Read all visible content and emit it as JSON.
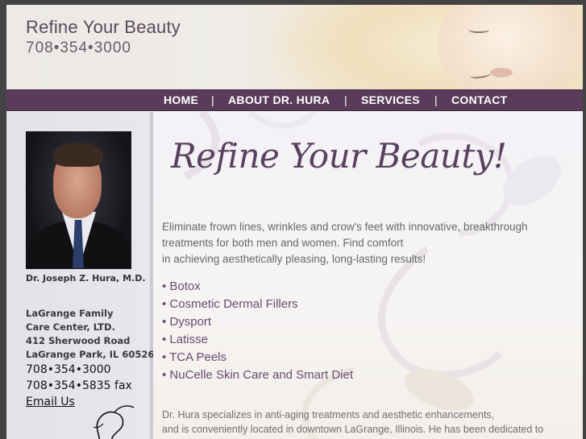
{
  "header": {
    "title": "Refine Your Beauty",
    "phone": "708•354•3000"
  },
  "nav": {
    "items": [
      {
        "label": "HOME"
      },
      {
        "label": "ABOUT DR. HURA"
      },
      {
        "label": "SERVICES"
      },
      {
        "label": "CONTACT"
      }
    ],
    "separator": "|"
  },
  "sidebar": {
    "doctor_name": "Dr. Joseph Z. Hura, M.D.",
    "address_lines": [
      "LaGrange Family",
      "Care Center, LTD.",
      "412 Sherwood Road",
      "LaGrange Park, IL 60526"
    ],
    "phone": "708•354•3000",
    "fax": "708•354•5835 fax",
    "email_label": "Email Us"
  },
  "main": {
    "heading": "Refine Your Beauty!",
    "intro_lines": [
      "Eliminate frown lines, wrinkles and crow's feet with innovative, breakthrough",
      "treatments for both men and women. Find comfort",
      "in achieving aesthetically pleasing, long-lasting results!"
    ],
    "treatments": [
      "• Botox",
      "• Cosmetic Dermal Fillers",
      "• Dysport",
      "• Latisse",
      "• TCA Peels",
      "• NuCelle Skin Care and Smart Diet"
    ],
    "outro_lines": [
      "Dr. Hura specializes in anti-aging treatments and aesthetic enhancements,",
      "and is conveniently located in downtown LaGrange, Illinois. He has been dedicated to"
    ]
  },
  "colors": {
    "nav_bg": "#5a3c5a",
    "accent_text": "#6a4a6e",
    "page_bg": "#434343"
  }
}
